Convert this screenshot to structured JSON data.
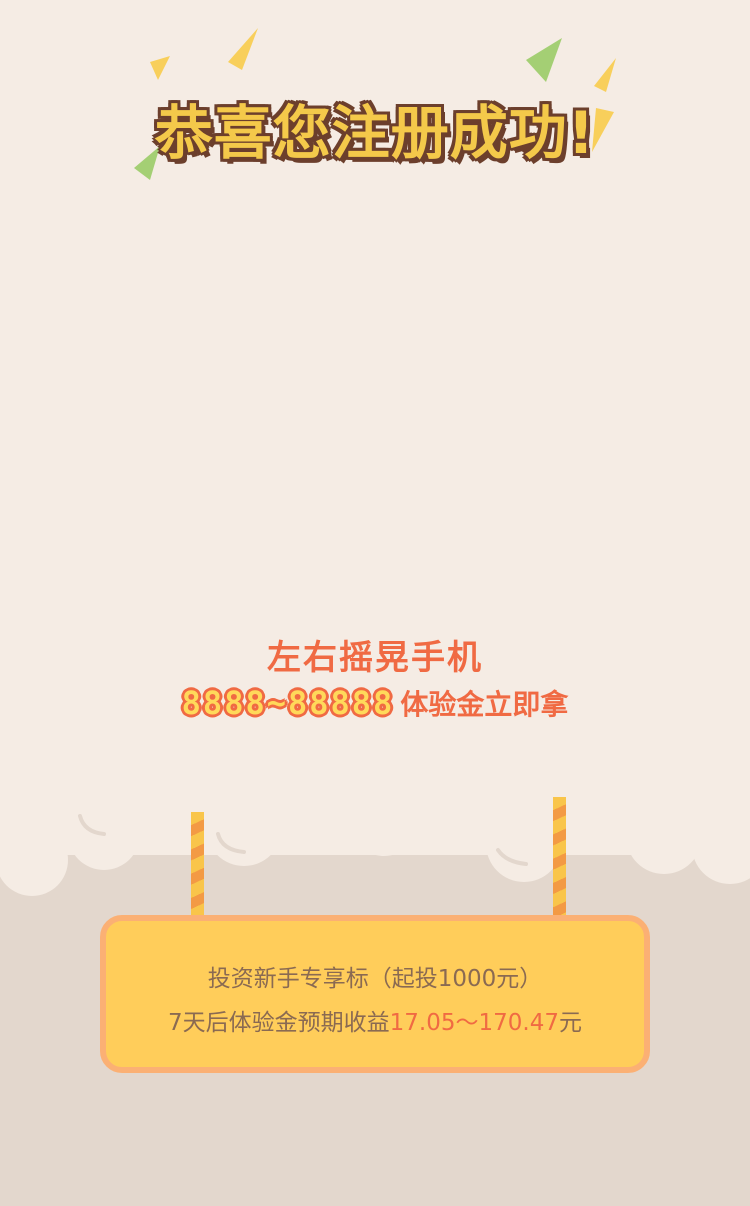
{
  "title": "恭喜您注册成功!",
  "shake": {
    "line1": "左右摇晃手机",
    "amount": "8888~88888",
    "suffix": "体验金立即拿"
  },
  "sign": {
    "line1": "投资新手专享标（起投1000元）",
    "line2_prefix": "7天后体验金预期收益",
    "line2_range": "17.05～170.47",
    "line2_suffix": "元"
  },
  "colors": {
    "background": "#f5ece4",
    "title_fill": "#f4c94a",
    "title_outline": "#6c3f2c",
    "accent": "#f06a43",
    "sign_fill": "#ffcd5a",
    "sign_border": "#fbb074",
    "ground": "#e3d7cd",
    "cloud": "#f5ece4"
  }
}
